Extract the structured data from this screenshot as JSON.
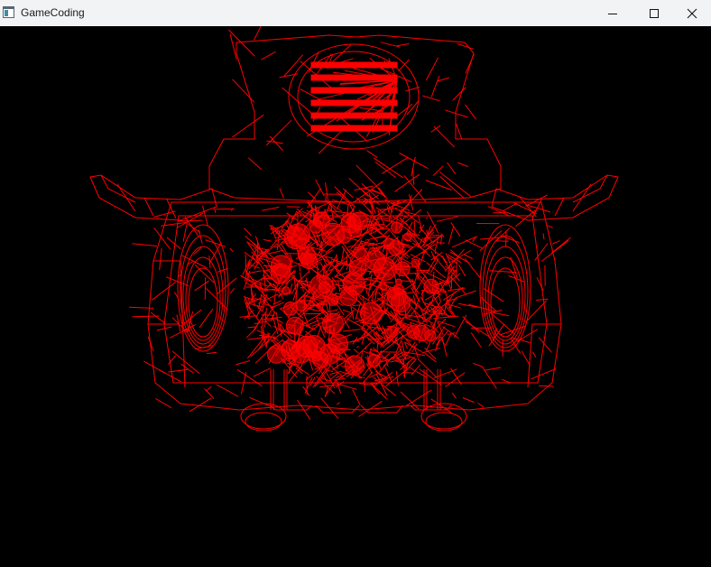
{
  "window": {
    "title": "GameCoding",
    "controls": {
      "minimize": "minimize-icon",
      "maximize": "maximize-icon",
      "close": "close-icon"
    }
  },
  "viewport": {
    "background": "#000000",
    "wire_color": "#ff0000",
    "render_mode": "wireframe",
    "subject": "character-model-front"
  }
}
